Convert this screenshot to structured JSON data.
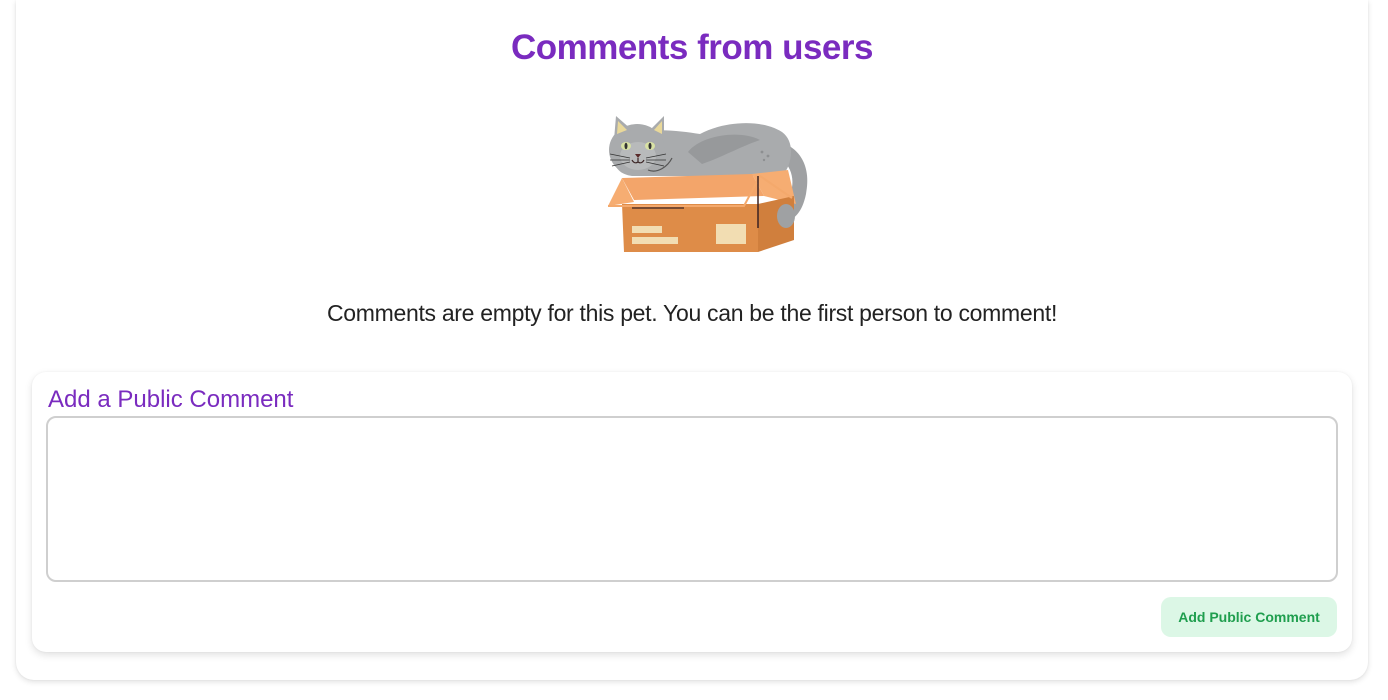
{
  "comments_section": {
    "title": "Comments from users",
    "empty_message": "Comments are empty for this pet. You can be the first person to comment!",
    "illustration": "cat-in-box-illustration"
  },
  "add_comment": {
    "heading": "Add a Public Comment",
    "textarea_value": "",
    "textarea_placeholder": "",
    "submit_label": "Add Public Comment"
  },
  "colors": {
    "heading_purple": "#7a2bbf",
    "button_bg": "#dcf7e6",
    "button_text": "#1f9e4e",
    "box_orange": "#de8c48",
    "cat_gray": "#a6a8aa"
  }
}
